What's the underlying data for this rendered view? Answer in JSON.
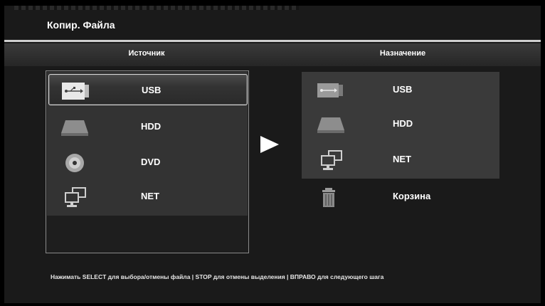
{
  "title": "Копир. Файла",
  "columns": {
    "source": "Источник",
    "destination": "Назначение"
  },
  "source_items": [
    {
      "label": "USB",
      "icon": "usb-icon",
      "selected": true
    },
    {
      "label": "HDD",
      "icon": "hdd-icon"
    },
    {
      "label": "DVD",
      "icon": "dvd-icon"
    },
    {
      "label": "NET",
      "icon": "network-icon"
    }
  ],
  "destination_items": [
    {
      "label": "USB",
      "icon": "usb-icon"
    },
    {
      "label": "HDD",
      "icon": "hdd-icon"
    },
    {
      "label": "NET",
      "icon": "network-icon"
    },
    {
      "label": "Корзина",
      "icon": "trash-icon"
    }
  ],
  "footer_hint": "Нажимать SELECT для выбора/отмены файла | STOP для отмены выделения | ВПРАВО для следующего шага"
}
